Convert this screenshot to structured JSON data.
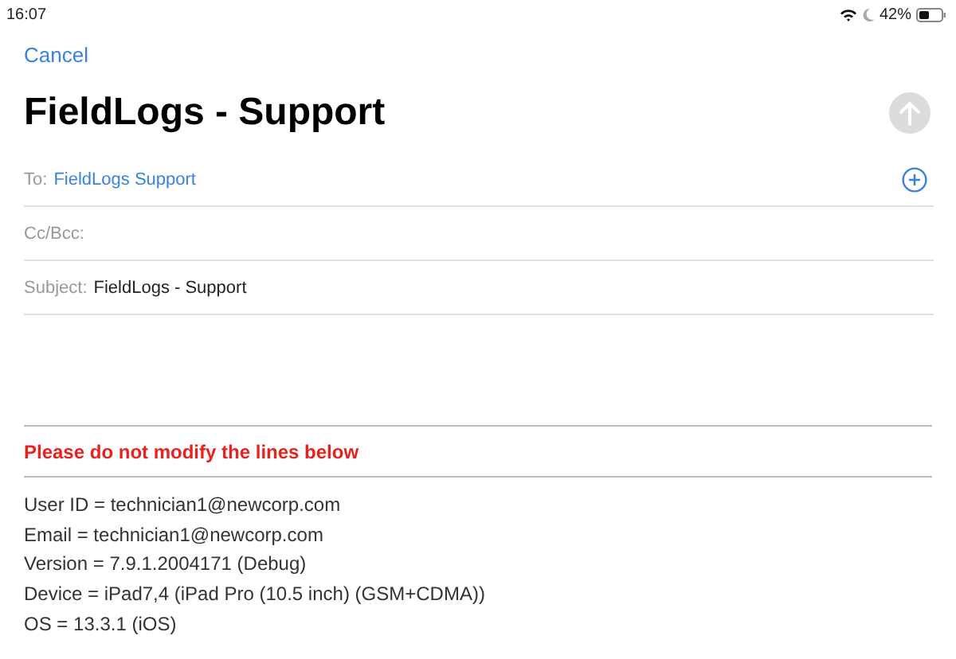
{
  "status_bar": {
    "time": "16:07",
    "battery": "42%"
  },
  "header": {
    "cancel": "Cancel",
    "title": "FieldLogs - Support",
    "send_disabled": true
  },
  "fields": [
    {
      "kind": "recipient",
      "label": "To:",
      "value": "FieldLogs Support"
    },
    {
      "kind": "plain",
      "label": "Cc/Bcc:"
    },
    {
      "kind": "plain",
      "label": "Subject:",
      "value": "FieldLogs - Support"
    }
  ],
  "body": {
    "warning": "Please do not modify the lines below",
    "lines": [
      "User ID = technician1@newcorp.com",
      "Email = technician1@newcorp.com",
      "Version = 7.9.1.2004171 (Debug)",
      "Device = iPad7,4 (iPad Pro (10.5 inch) (GSM+CDMA))",
      "OS = 13.3.1 (iOS)"
    ]
  }
}
